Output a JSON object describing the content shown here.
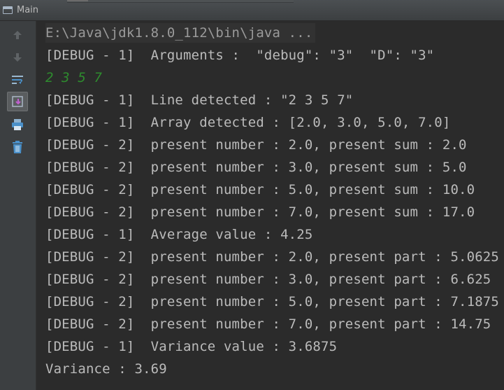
{
  "window": {
    "title": "Main"
  },
  "toolbar": {
    "tools": [
      {
        "icon": "up-arrow-icon"
      },
      {
        "icon": "down-arrow-icon"
      },
      {
        "icon": "soft-wrap-icon"
      },
      {
        "icon": "scroll-to-end-icon"
      },
      {
        "icon": "print-icon"
      },
      {
        "icon": "trash-icon"
      }
    ]
  },
  "console": {
    "command": "E:\\Java\\jdk1.8.0_112\\bin\\java ...",
    "user_input": "2 3 5 7",
    "lines": [
      "[DEBUG - 1]  Arguments :  \"debug\": \"3\"  \"D\": \"3\"",
      "[DEBUG - 1]  Line detected : \"2 3 5 7\"",
      "[DEBUG - 1]  Array detected : [2.0, 3.0, 5.0, 7.0]",
      "[DEBUG - 2]  present number : 2.0, present sum : 2.0",
      "[DEBUG - 2]  present number : 3.0, present sum : 5.0",
      "[DEBUG - 2]  present number : 5.0, present sum : 10.0",
      "[DEBUG - 2]  present number : 7.0, present sum : 17.0",
      "[DEBUG - 1]  Average value : 4.25",
      "[DEBUG - 2]  present number : 2.0, present part : 5.0625",
      "[DEBUG - 2]  present number : 3.0, present part : 6.625",
      "[DEBUG - 2]  present number : 5.0, present part : 7.1875",
      "[DEBUG - 2]  present number : 7.0, present part : 14.75",
      "[DEBUG - 1]  Variance value : 3.6875",
      "Variance : 3.69"
    ]
  }
}
